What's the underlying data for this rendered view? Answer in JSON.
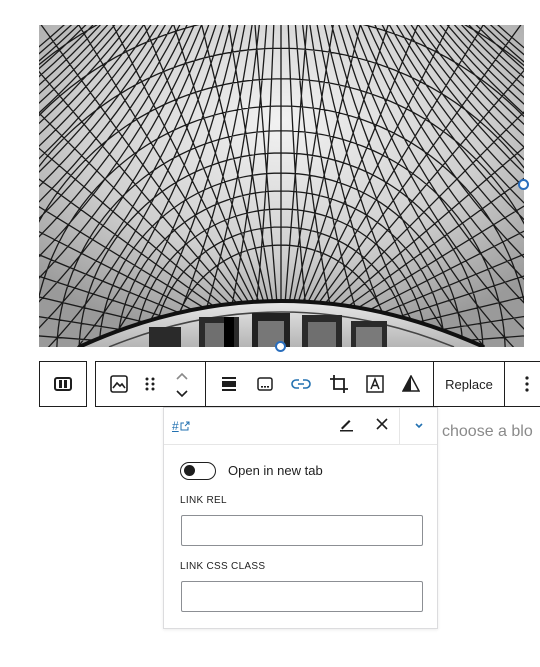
{
  "image": {
    "subject": "black-and-white photograph of a triangulated glass roof over a round building"
  },
  "toolbar": {
    "groups": [
      {
        "items": [
          "block-switcher-icon"
        ]
      },
      {
        "items": [
          "image-icon",
          "drag-handle-icon",
          "move-up-down-icon"
        ]
      },
      {
        "items": [
          "align-icon",
          "caption-icon",
          "link-icon",
          "crop-icon",
          "text-over-image-icon",
          "duotone-icon"
        ]
      },
      {
        "items": [
          "replace"
        ]
      },
      {
        "items": [
          "more-options-icon"
        ]
      }
    ],
    "replace_label": "Replace"
  },
  "appender": {
    "text": "choose a blo"
  },
  "link_popover": {
    "url": "#",
    "open_new_tab_label": "Open in new tab",
    "open_new_tab_checked": false,
    "link_rel_label": "LINK REL",
    "link_rel_value": "",
    "link_css_class_label": "LINK CSS CLASS",
    "link_css_class_value": ""
  },
  "colors": {
    "accent": "#2271b1",
    "handle": "#2a6ebd",
    "text": "#1e1e1e",
    "muted": "#8a8a8a"
  }
}
